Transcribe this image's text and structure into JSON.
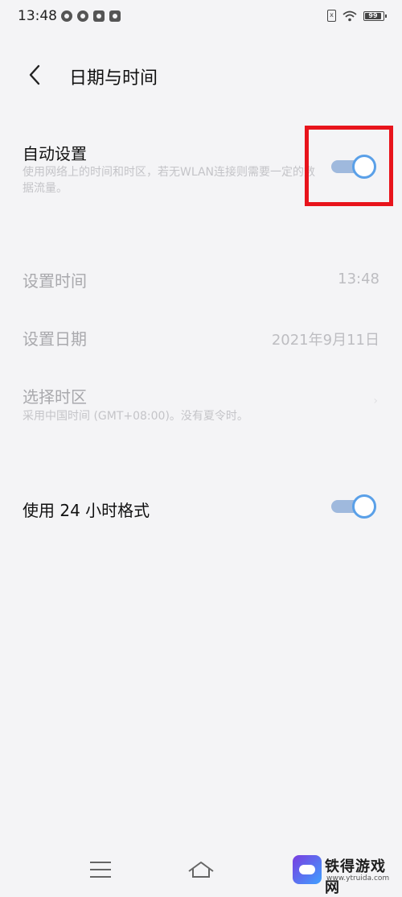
{
  "status_bar": {
    "time": "13:48",
    "notifications": [
      "wechat-icon",
      "location-icon",
      "mail-icon",
      "video-icon"
    ],
    "battery_level": "99"
  },
  "header": {
    "title": "日期与时间"
  },
  "auto_setting": {
    "title": "自动设置",
    "desc": "使用网络上的时间和时区，若无WLAN连接则需要一定的数据流量。",
    "enabled": true
  },
  "set_time": {
    "title": "设置时间",
    "value": "13:48"
  },
  "set_date": {
    "title": "设置日期",
    "value": "2021年9月11日"
  },
  "timezone": {
    "title": "选择时区",
    "desc": "采用中国时间 (GMT+08:00)。没有夏令时。"
  },
  "format24": {
    "title": "使用 24 小时格式",
    "enabled": true
  },
  "watermark": {
    "name": "铁得游戏网",
    "url": "www.ytruida.com"
  },
  "colors": {
    "toggle_on": "#5aa0e8",
    "highlight": "#e8141c",
    "background": "#f4f4f6"
  }
}
